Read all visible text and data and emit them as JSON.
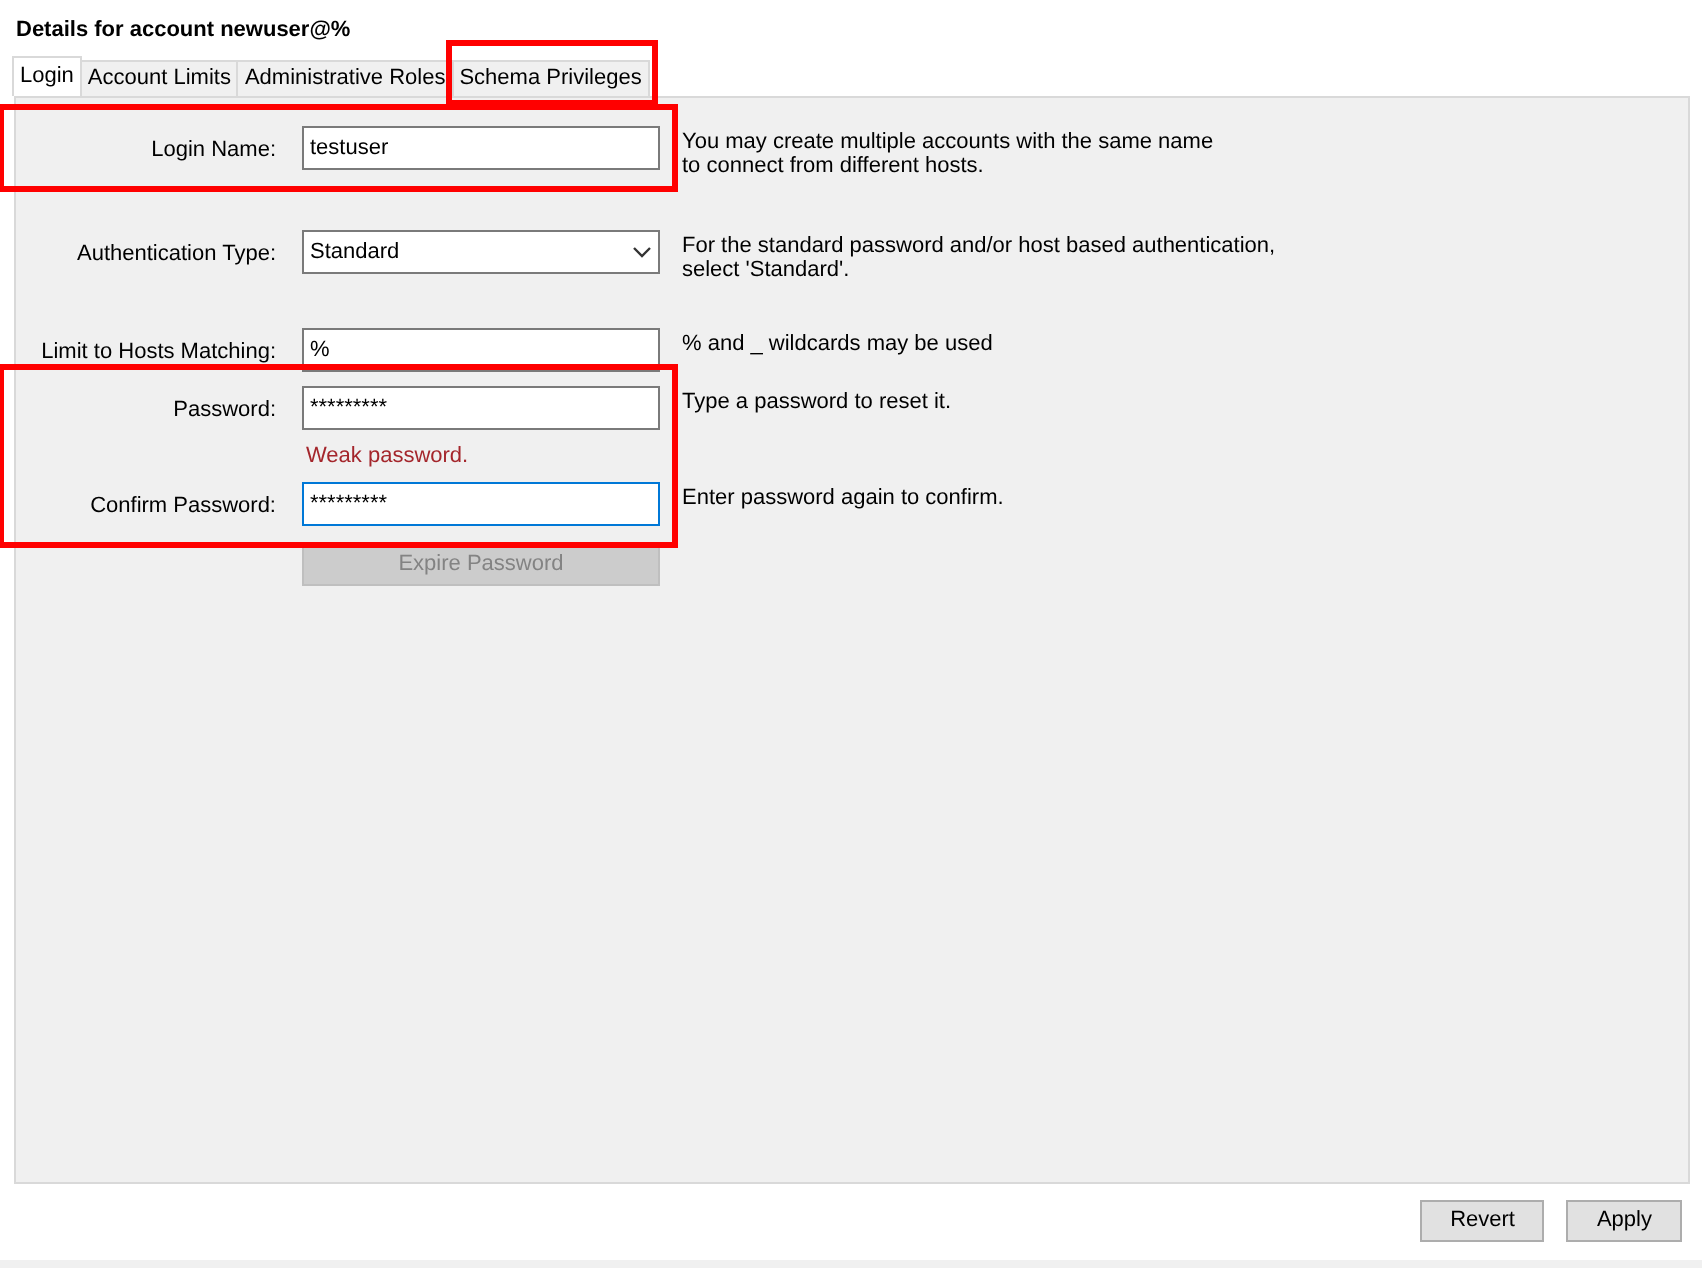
{
  "title": "Details for account newuser@%",
  "tabs": [
    {
      "label": "Login",
      "selected": true,
      "highlighted": false
    },
    {
      "label": "Account Limits",
      "selected": false,
      "highlighted": false
    },
    {
      "label": "Administrative Roles",
      "selected": false,
      "highlighted": false
    },
    {
      "label": "Schema Privileges",
      "selected": false,
      "highlighted": true
    }
  ],
  "form_groups": [
    {
      "highlighted": true,
      "rows": [
        {
          "kind": "input",
          "label": "Login Name:",
          "value": "testuser",
          "focused": false,
          "help": "You may create multiple accounts with the same name\nto connect from different hosts."
        }
      ]
    },
    {
      "highlighted": false,
      "rows": [
        {
          "kind": "select",
          "label": "Authentication Type:",
          "value": "Standard",
          "help": "For the standard password and/or host based authentication,\nselect 'Standard'."
        }
      ]
    },
    {
      "highlighted": false,
      "rows": [
        {
          "kind": "input",
          "label": "Limit to Hosts Matching:",
          "value": "%",
          "focused": false,
          "help": "% and _ wildcards may be used"
        }
      ]
    },
    {
      "highlighted": true,
      "rows": [
        {
          "kind": "input",
          "label": "Password:",
          "value": "*********",
          "focused": false,
          "help": "Type a password to reset it."
        },
        {
          "kind": "message",
          "text": "Weak password."
        },
        {
          "kind": "input",
          "label": "Confirm Password:",
          "value": "*********",
          "focused": true,
          "help": "Enter password again to confirm."
        }
      ]
    },
    {
      "highlighted": false,
      "rows": [
        {
          "kind": "button",
          "label": "Expire Password",
          "disabled": true
        }
      ]
    }
  ],
  "buttons": [
    {
      "label": "Revert"
    },
    {
      "label": "Apply"
    }
  ]
}
